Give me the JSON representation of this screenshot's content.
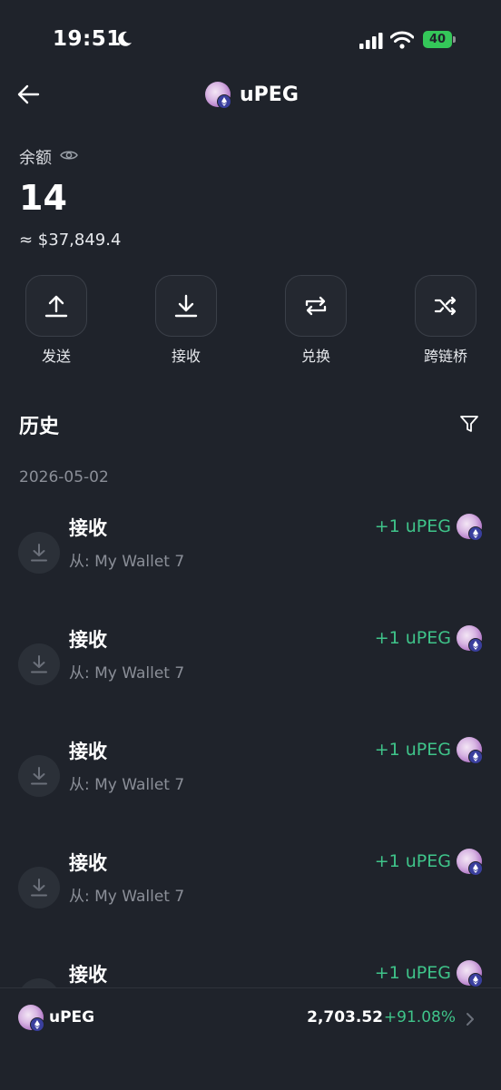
{
  "status_bar": {
    "time": "19:51",
    "battery": "40"
  },
  "header": {
    "title": "uPEG"
  },
  "balance": {
    "label": "余额",
    "amount": "14",
    "fiat": "≈ $37,849.4"
  },
  "actions": [
    {
      "label": "发送",
      "icon": "upload-icon"
    },
    {
      "label": "接收",
      "icon": "download-icon"
    },
    {
      "label": "兑换",
      "icon": "swap-icon"
    },
    {
      "label": "跨链桥",
      "icon": "shuffle-icon"
    }
  ],
  "history": {
    "title": "历史",
    "date": "2026-05-02",
    "transactions": [
      {
        "title": "接收",
        "from": "从: My Wallet 7",
        "amount": "+1 uPEG"
      },
      {
        "title": "接收",
        "from": "从: My Wallet 7",
        "amount": "+1 uPEG"
      },
      {
        "title": "接收",
        "from": "从: My Wallet 7",
        "amount": "+1 uPEG"
      },
      {
        "title": "接收",
        "from": "从: My Wallet 7",
        "amount": "+1 uPEG"
      },
      {
        "title": "接收",
        "from": "",
        "amount": "+1 uPEG"
      }
    ]
  },
  "bottom_bar": {
    "token": "uPEG",
    "price": "2,703.52",
    "change": "+91.08%"
  },
  "colors": {
    "background": "#1f232b",
    "positive": "#3fc48a",
    "muted": "#8b8f98"
  }
}
